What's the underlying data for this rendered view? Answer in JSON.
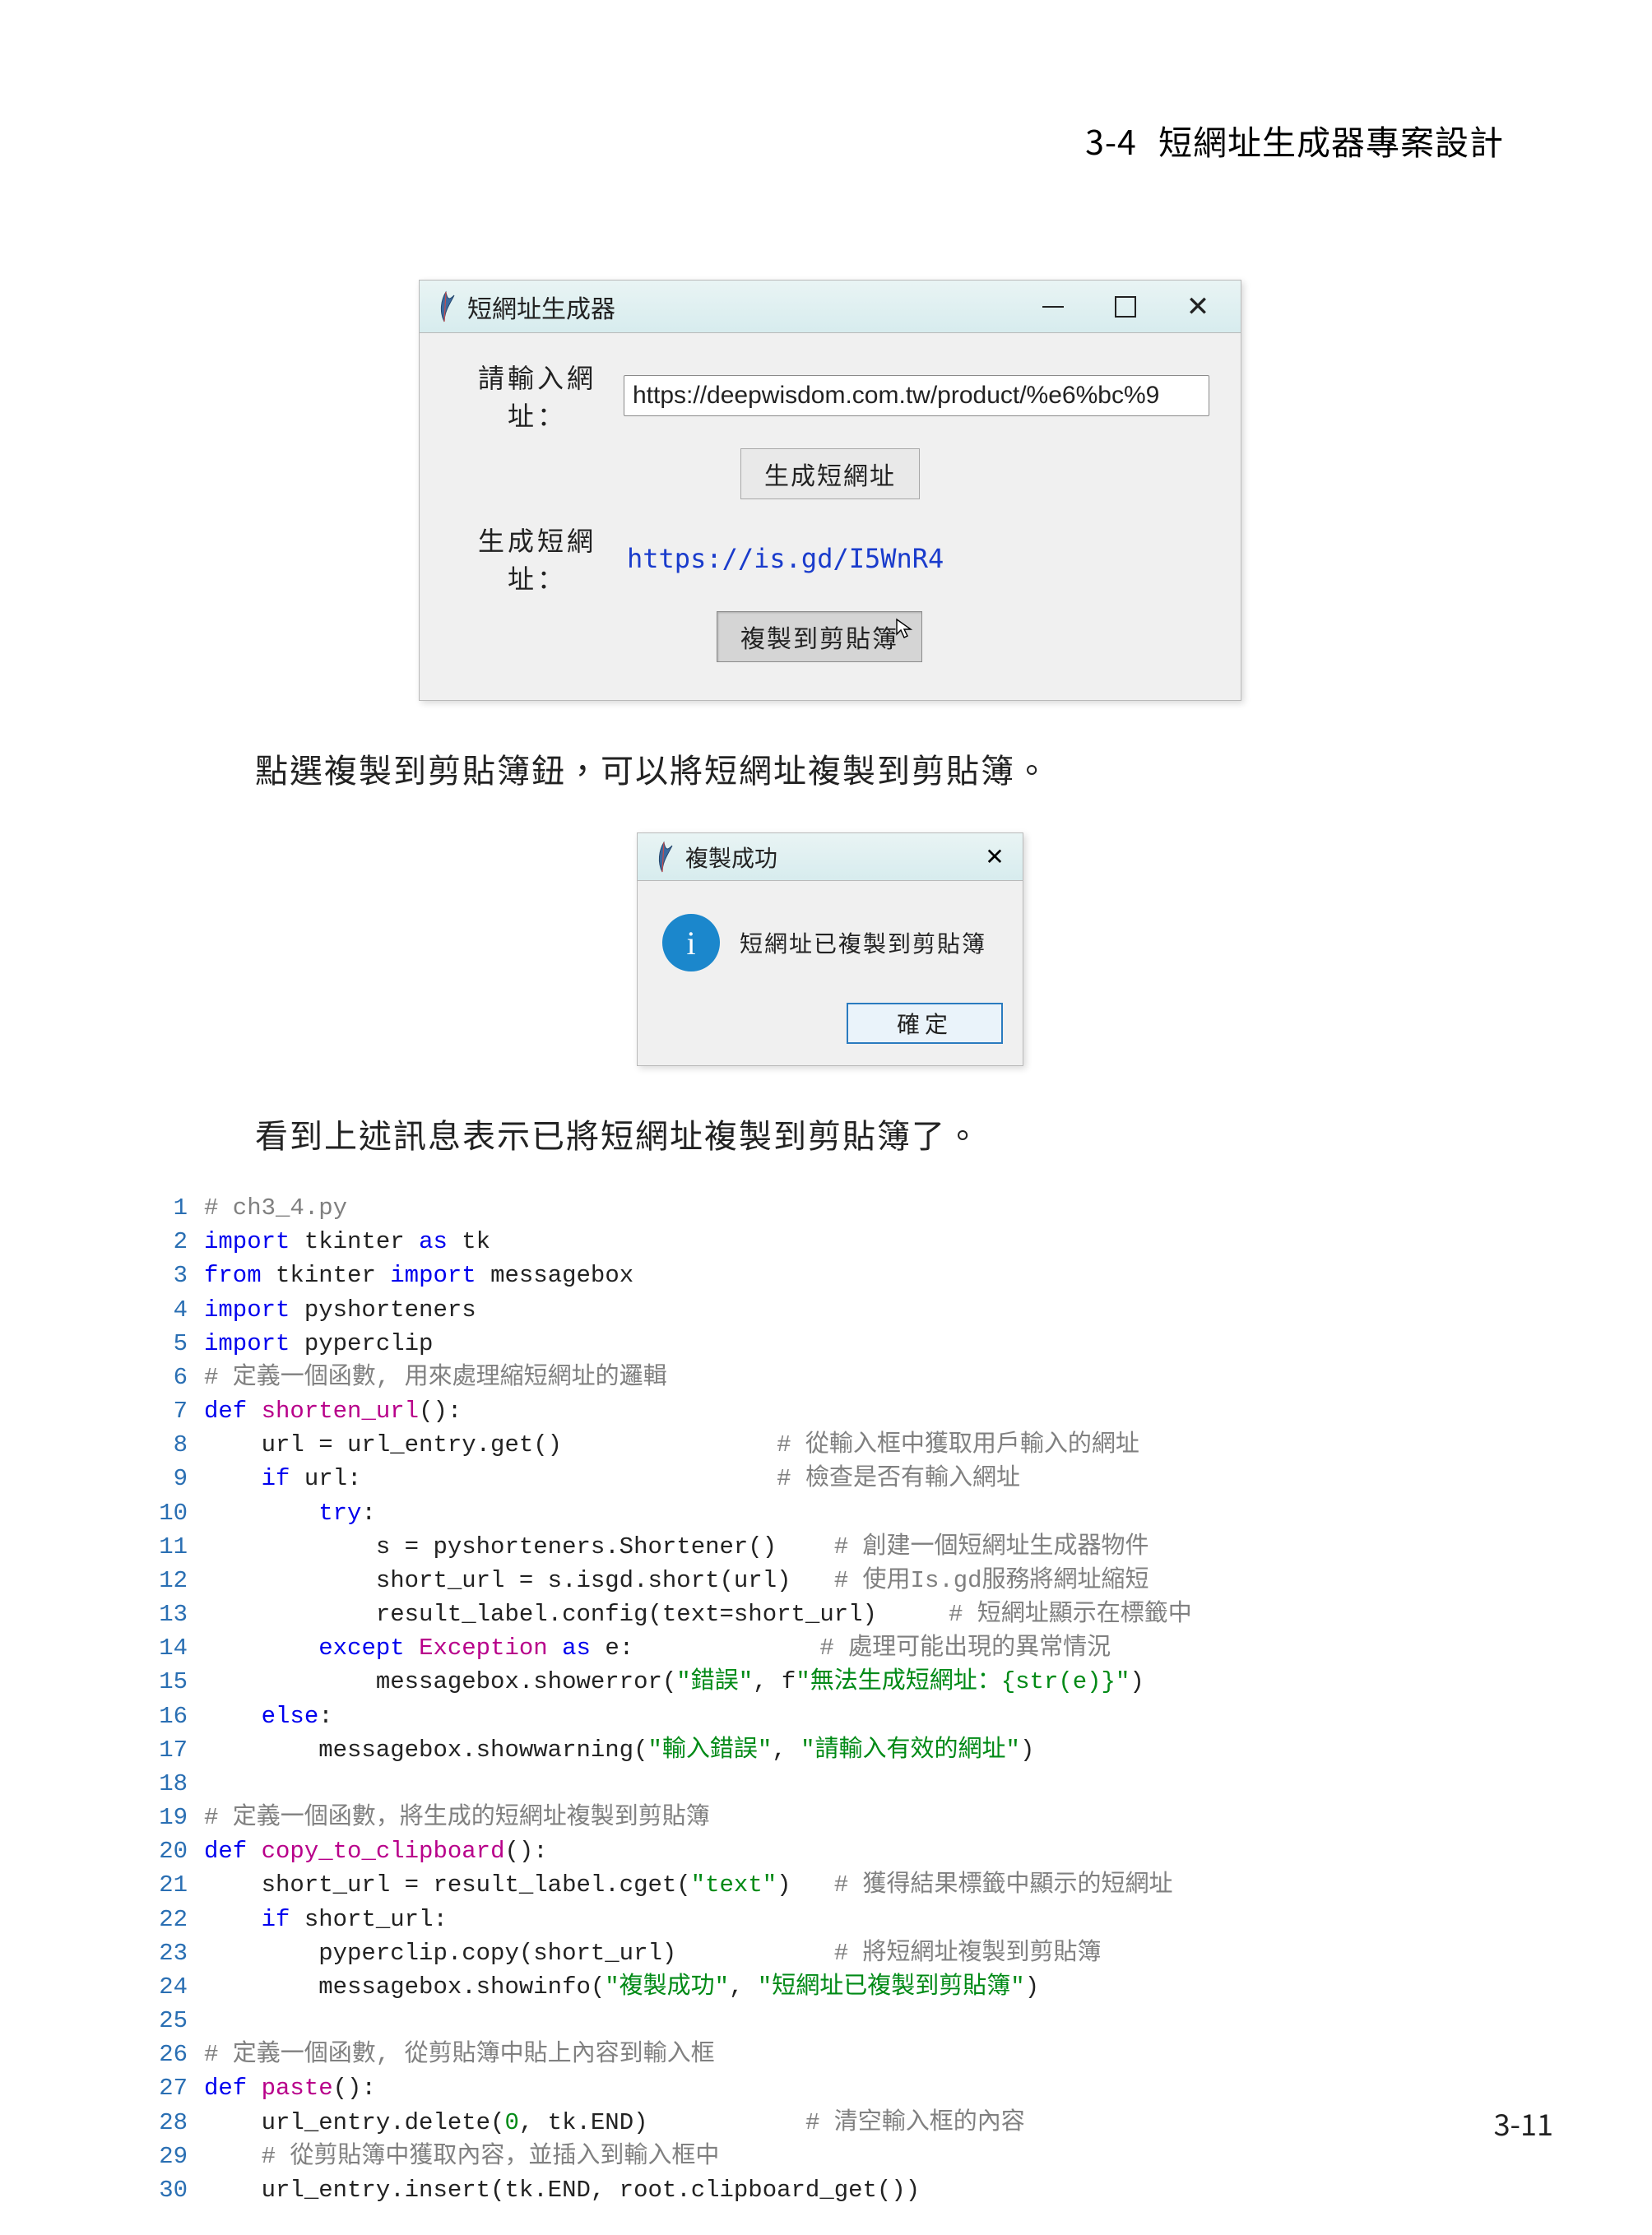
{
  "header": {
    "num": "3-4",
    "title": "短網址生成器專案設計"
  },
  "mainWindow": {
    "title": "短網址生成器",
    "labelInput": "請輸入網址：",
    "entryValue": "https://deepwisdom.com.tw/product/%e6%bc%9",
    "btnGenerate": "生成短網址",
    "labelResult": "生成短網址：",
    "shortUrl": "https://is.gd/I5WnR4",
    "btnCopy": "複製到剪貼簿"
  },
  "para1": "點選複製到剪貼簿鈕，可以將短網址複製到剪貼簿。",
  "msgBox": {
    "title": "複製成功",
    "body": "短網址已複製到剪貼簿",
    "ok": "確定"
  },
  "para2": "看到上述訊息表示已將短網址複製到剪貼簿了。",
  "code": [
    {
      "n": 1,
      "c": "blue",
      "seg": [
        {
          "t": "# ch3_4.py",
          "cls": "cm"
        }
      ]
    },
    {
      "n": 2,
      "c": "blue",
      "seg": [
        {
          "t": "import",
          "cls": "kw"
        },
        {
          "t": " tkinter "
        },
        {
          "t": "as",
          "cls": "kw"
        },
        {
          "t": " tk"
        }
      ]
    },
    {
      "n": 3,
      "c": "blue",
      "seg": [
        {
          "t": "from",
          "cls": "kw"
        },
        {
          "t": " tkinter "
        },
        {
          "t": "import",
          "cls": "kw"
        },
        {
          "t": " messagebox"
        }
      ]
    },
    {
      "n": 4,
      "c": "blue",
      "seg": [
        {
          "t": "import",
          "cls": "kw"
        },
        {
          "t": " pyshorteners"
        }
      ]
    },
    {
      "n": 5,
      "c": "blue",
      "seg": [
        {
          "t": "import",
          "cls": "kw"
        },
        {
          "t": " pyperclip"
        }
      ]
    },
    {
      "n": 6,
      "c": "blue",
      "seg": [
        {
          "t": "# 定義一個函數, 用來處理縮短網址的邏輯",
          "cls": "cm"
        }
      ]
    },
    {
      "n": 7,
      "c": "blue",
      "seg": [
        {
          "t": "def",
          "cls": "kw"
        },
        {
          "t": " "
        },
        {
          "t": "shorten_url",
          "cls": "fn"
        },
        {
          "t": "():"
        }
      ]
    },
    {
      "n": 8,
      "c": "blue",
      "seg": [
        {
          "t": "    url = url_entry.get()               "
        },
        {
          "t": "# 從輸入框中獲取用戶輸入的網址",
          "cls": "cm"
        }
      ]
    },
    {
      "n": 9,
      "c": "blue",
      "seg": [
        {
          "t": "    "
        },
        {
          "t": "if",
          "cls": "kw"
        },
        {
          "t": " url:                             "
        },
        {
          "t": "# 檢查是否有輸入網址",
          "cls": "cm"
        }
      ]
    },
    {
      "n": 10,
      "c": "blue",
      "seg": [
        {
          "t": "        "
        },
        {
          "t": "try",
          "cls": "kw"
        },
        {
          "t": ":"
        }
      ]
    },
    {
      "n": 11,
      "c": "blue",
      "seg": [
        {
          "t": "            s = pyshorteners.Shortener()    "
        },
        {
          "t": "# 創建一個短網址生成器物件",
          "cls": "cm"
        }
      ]
    },
    {
      "n": 12,
      "c": "blue",
      "seg": [
        {
          "t": "            short_url = s.isgd.short(url)   "
        },
        {
          "t": "# 使用Is.gd服務將網址縮短",
          "cls": "cm"
        }
      ]
    },
    {
      "n": 13,
      "c": "blue",
      "seg": [
        {
          "t": "            result_label.config(text=short_url)     "
        },
        {
          "t": "# 短網址顯示在標籤中",
          "cls": "cm"
        }
      ]
    },
    {
      "n": 14,
      "c": "blue",
      "seg": [
        {
          "t": "        "
        },
        {
          "t": "except",
          "cls": "kw"
        },
        {
          "t": " "
        },
        {
          "t": "Exception",
          "cls": "fn"
        },
        {
          "t": " "
        },
        {
          "t": "as",
          "cls": "kw"
        },
        {
          "t": " e:             "
        },
        {
          "t": "# 處理可能出現的異常情況",
          "cls": "cm"
        }
      ]
    },
    {
      "n": 15,
      "c": "blue",
      "seg": [
        {
          "t": "            messagebox.showerror("
        },
        {
          "t": "\"錯誤\"",
          "cls": "st"
        },
        {
          "t": ", f"
        },
        {
          "t": "\"無法生成短網址：{str(e)}\"",
          "cls": "st"
        },
        {
          "t": ")"
        }
      ]
    },
    {
      "n": 16,
      "c": "blue",
      "seg": [
        {
          "t": "    "
        },
        {
          "t": "else",
          "cls": "kw"
        },
        {
          "t": ":"
        }
      ]
    },
    {
      "n": 17,
      "c": "blue",
      "seg": [
        {
          "t": "        messagebox.showwarning("
        },
        {
          "t": "\"輸入錯誤\"",
          "cls": "st"
        },
        {
          "t": ", "
        },
        {
          "t": "\"請輸入有效的網址\"",
          "cls": "st"
        },
        {
          "t": ")"
        }
      ]
    },
    {
      "n": 18,
      "c": "blue",
      "seg": [
        {
          "t": ""
        }
      ]
    },
    {
      "n": 19,
      "c": "blue",
      "seg": [
        {
          "t": "# 定義一個函數，將生成的短網址複製到剪貼簿",
          "cls": "cm"
        }
      ]
    },
    {
      "n": 20,
      "c": "blue",
      "seg": [
        {
          "t": "def",
          "cls": "kw"
        },
        {
          "t": " "
        },
        {
          "t": "copy_to_clipboard",
          "cls": "fn"
        },
        {
          "t": "():"
        }
      ]
    },
    {
      "n": 21,
      "c": "blue",
      "seg": [
        {
          "t": "    short_url = result_label.cget("
        },
        {
          "t": "\"text\"",
          "cls": "st"
        },
        {
          "t": ")   "
        },
        {
          "t": "# 獲得結果標籤中顯示的短網址",
          "cls": "cm"
        }
      ]
    },
    {
      "n": 22,
      "c": "blue",
      "seg": [
        {
          "t": "    "
        },
        {
          "t": "if",
          "cls": "kw"
        },
        {
          "t": " short_url:"
        }
      ]
    },
    {
      "n": 23,
      "c": "blue",
      "seg": [
        {
          "t": "        pyperclip.copy(short_url)           "
        },
        {
          "t": "# 將短網址複製到剪貼簿",
          "cls": "cm"
        }
      ]
    },
    {
      "n": 24,
      "c": "blue",
      "seg": [
        {
          "t": "        messagebox.showinfo("
        },
        {
          "t": "\"複製成功\"",
          "cls": "st"
        },
        {
          "t": ", "
        },
        {
          "t": "\"短網址已複製到剪貼簿\"",
          "cls": "st"
        },
        {
          "t": ")"
        }
      ]
    },
    {
      "n": 25,
      "c": "blue",
      "seg": [
        {
          "t": ""
        }
      ]
    },
    {
      "n": 26,
      "c": "blue",
      "seg": [
        {
          "t": "# 定義一個函數, 從剪貼簿中貼上內容到輸入框",
          "cls": "cm"
        }
      ]
    },
    {
      "n": 27,
      "c": "blue",
      "seg": [
        {
          "t": "def",
          "cls": "kw"
        },
        {
          "t": " "
        },
        {
          "t": "paste",
          "cls": "fn"
        },
        {
          "t": "():"
        }
      ]
    },
    {
      "n": 28,
      "c": "blue",
      "seg": [
        {
          "t": "    url_entry.delete("
        },
        {
          "t": "0",
          "cls": "st"
        },
        {
          "t": ", tk.END)           "
        },
        {
          "t": "# 清空輸入框的內容",
          "cls": "cm"
        }
      ]
    },
    {
      "n": 29,
      "c": "blue",
      "seg": [
        {
          "t": "    "
        },
        {
          "t": "# 從剪貼簿中獲取內容，並插入到輸入框中",
          "cls": "cm"
        }
      ]
    },
    {
      "n": 30,
      "c": "blue",
      "seg": [
        {
          "t": "    url_entry.insert(tk.END, root.clipboard_get())"
        }
      ]
    }
  ],
  "pageNumber": "3-11"
}
